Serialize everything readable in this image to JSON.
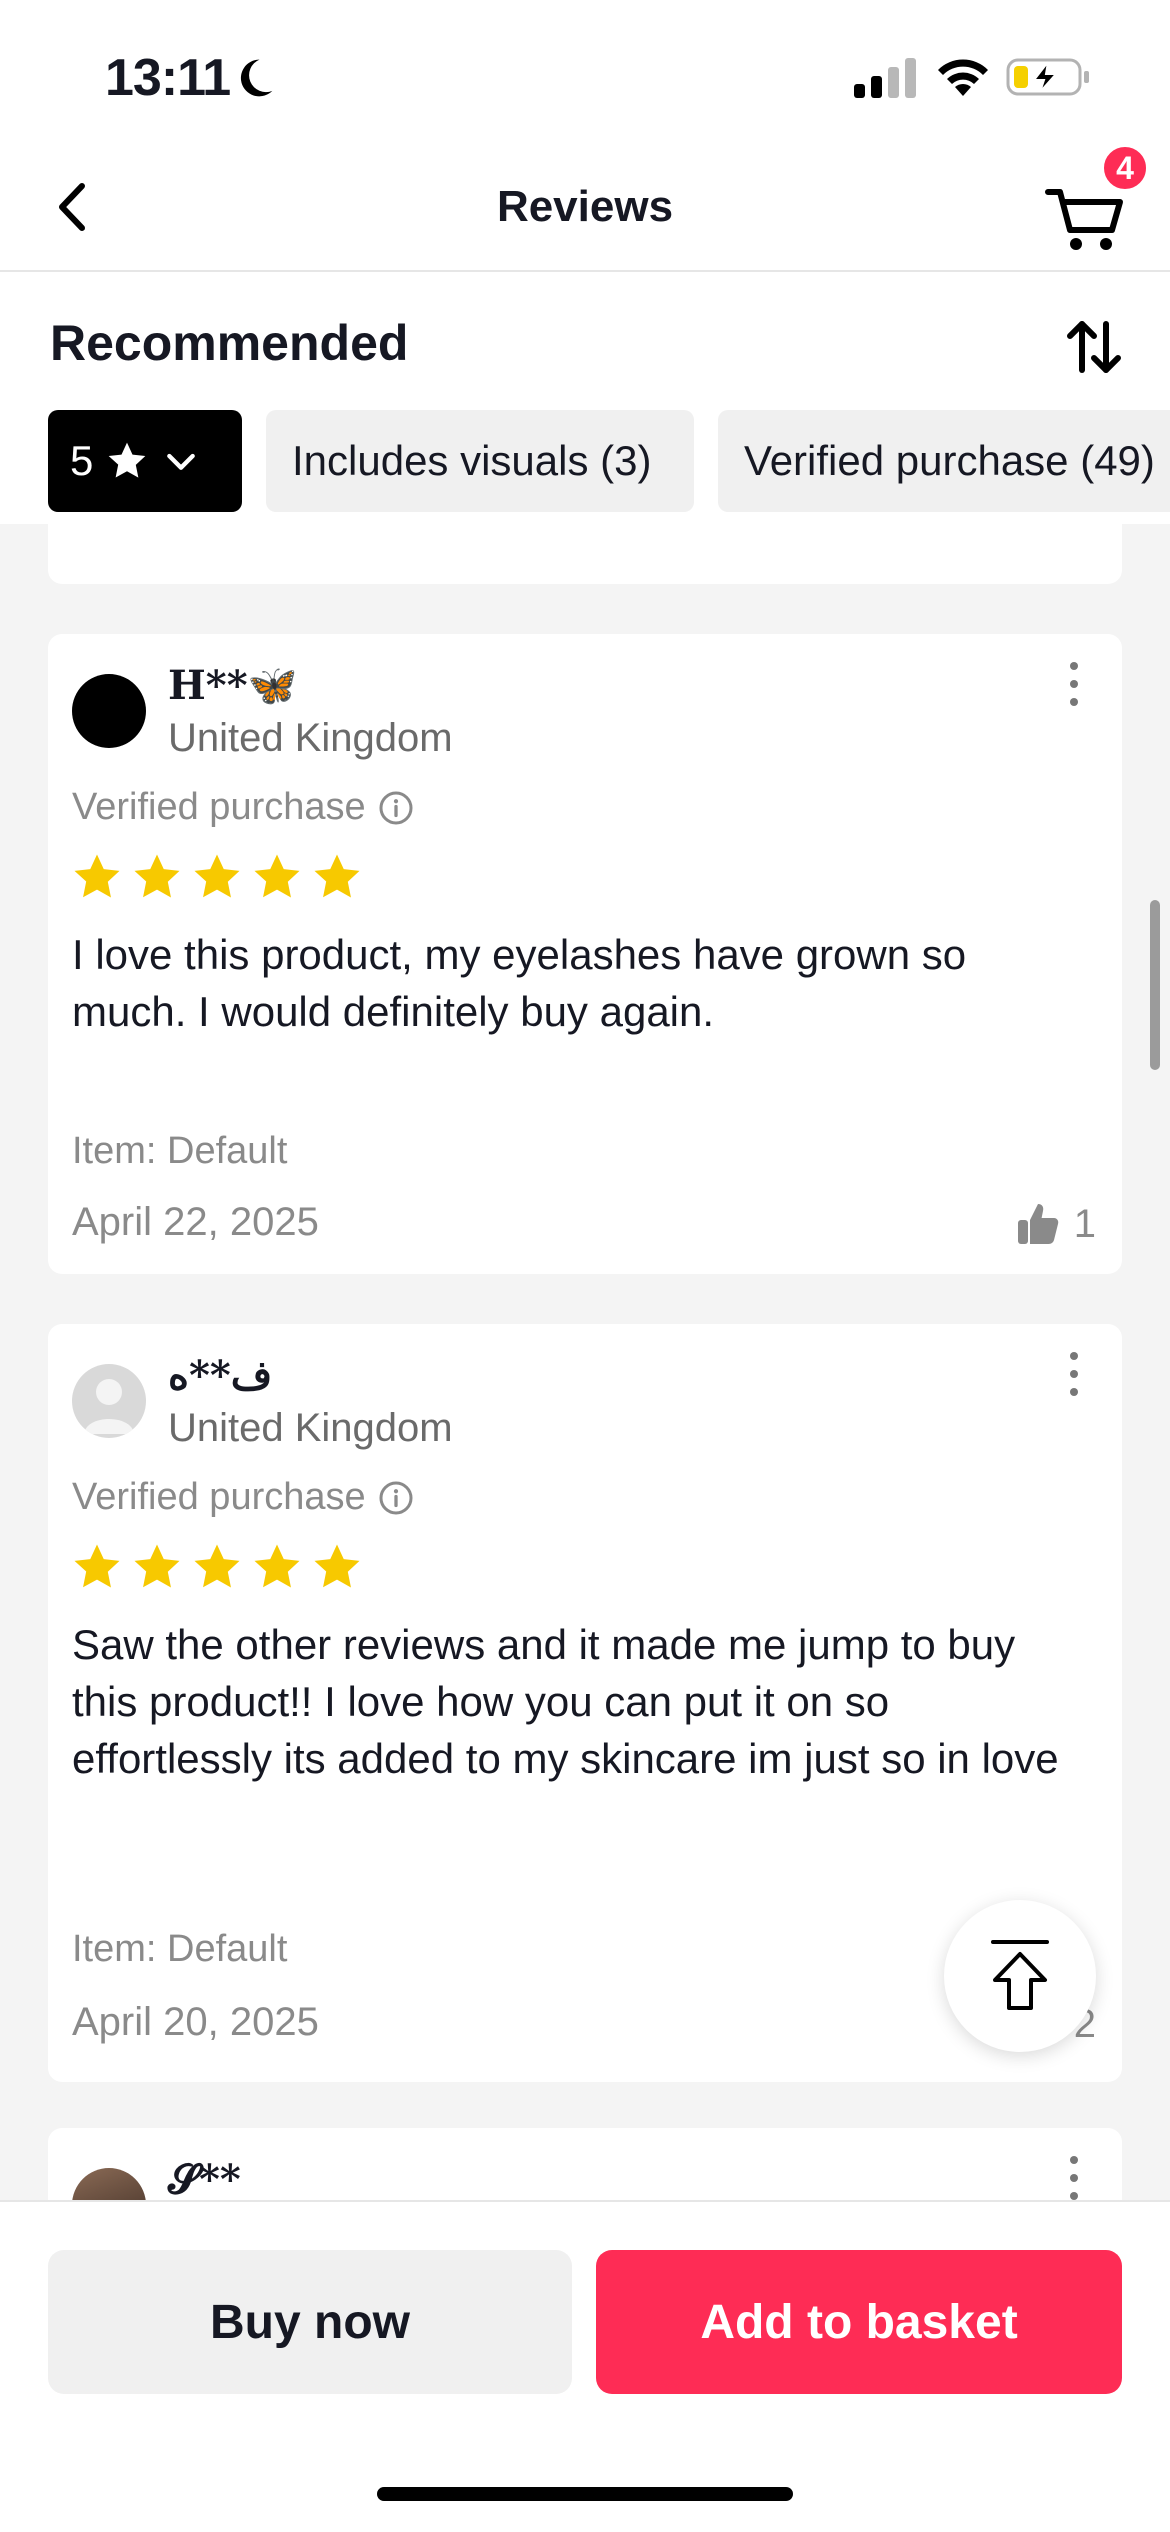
{
  "status_bar": {
    "time": "13:11"
  },
  "nav": {
    "title": "Reviews",
    "cart_count": "4"
  },
  "filters": {
    "sort_label": "Recommended",
    "star_chip": "5",
    "visuals_chip": "Includes visuals (3)",
    "verified_chip": "Verified purchase (49)"
  },
  "reviews": [
    {
      "user": "H**🦋",
      "country": "United Kingdom",
      "verified": "Verified purchase",
      "rating": 5,
      "text": "I love this product, my eyelashes have grown so much. I would definitely buy again.",
      "item": "Item: Default",
      "date": "April 22, 2025",
      "likes": "1"
    },
    {
      "user": "ف**ه",
      "country": "United Kingdom",
      "verified": "Verified purchase",
      "rating": 5,
      "text": "Saw the other reviews and it made me jump to buy this product!! I love how you can put it on so effortlessly its added to my skincare im just so in love",
      "item": "Item: Default",
      "date": "April 20, 2025",
      "likes": "2"
    },
    {
      "user": "𝓢**"
    }
  ],
  "actions": {
    "buy_now": "Buy now",
    "add_to_basket": "Add to basket"
  },
  "colors": {
    "accent": "#fe2c55",
    "star": "#f7c900",
    "muted": "#8a8a8a"
  },
  "icons": [
    "moon-icon",
    "signal-icon",
    "wifi-icon",
    "battery-icon",
    "back-icon",
    "cart-icon",
    "sort-icon",
    "star-icon",
    "chevron-down-icon",
    "info-icon",
    "more-icon",
    "thumbs-up-icon",
    "back-to-top-icon"
  ]
}
